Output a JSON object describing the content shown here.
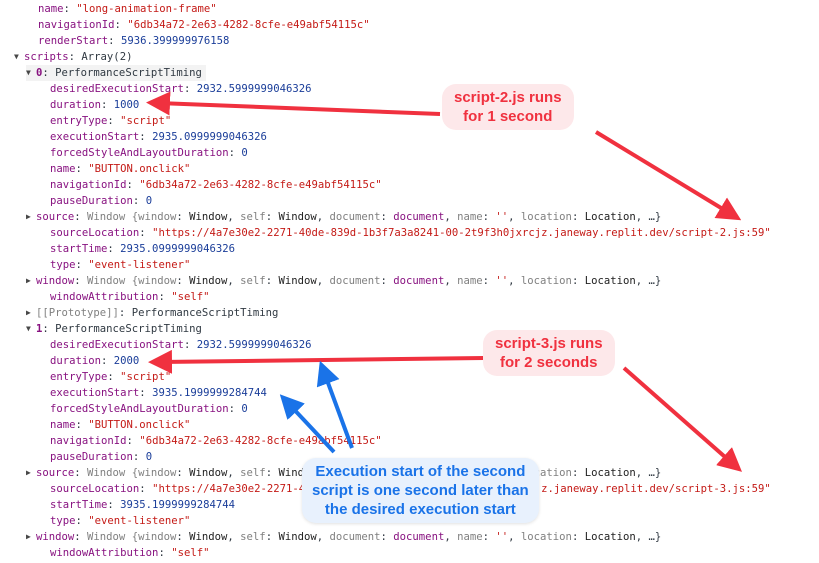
{
  "console": {
    "rows": [
      {
        "indent": 1,
        "key": "name",
        "type": "string",
        "value": "\"long-animation-frame\""
      },
      {
        "indent": 1,
        "key": "navigationId",
        "type": "string",
        "value": "\"6db34a72-2e63-4282-8cfe-e49abf54115c\""
      },
      {
        "indent": 1,
        "key": "renderStart",
        "type": "number",
        "value": "5936.399999976158"
      },
      {
        "indent": 0,
        "toggle": "expanded",
        "key": "scripts",
        "type": "text",
        "value": "Array(2)"
      },
      {
        "indent": 1,
        "toggle": "expanded",
        "index": true,
        "key": "0",
        "type": "text",
        "value": "PerformanceScriptTiming",
        "highlight": true
      },
      {
        "indent": 2,
        "key": "desiredExecutionStart",
        "type": "number",
        "value": "2932.5999999046326"
      },
      {
        "indent": 2,
        "key": "duration",
        "type": "number",
        "value": "1000"
      },
      {
        "indent": 2,
        "key": "entryType",
        "type": "string",
        "value": "\"script\""
      },
      {
        "indent": 2,
        "key": "executionStart",
        "type": "number",
        "value": "2935.0999999046326"
      },
      {
        "indent": 2,
        "key": "forcedStyleAndLayoutDuration",
        "type": "number",
        "value": "0"
      },
      {
        "indent": 2,
        "key": "name",
        "type": "string",
        "value": "\"BUTTON.onclick\""
      },
      {
        "indent": 2,
        "key": "navigationId",
        "type": "string",
        "value": "\"6db34a72-2e63-4282-8cfe-e49abf54115c\""
      },
      {
        "indent": 2,
        "key": "pauseDuration",
        "type": "number",
        "value": "0"
      },
      {
        "indent": 1,
        "toggle": "collapsed",
        "key": "source",
        "type": "window",
        "value": "Window {window: Window, self: Window, document: document, name: '', location: Location, …}"
      },
      {
        "indent": 2,
        "key": "sourceLocation",
        "type": "string",
        "value": "\"https://4a7e30e2-2271-40de-839d-1b3f7a3a8241-00-2t9f3h0jxrcjz.janeway.replit.dev/script-2.js:59\""
      },
      {
        "indent": 2,
        "key": "startTime",
        "type": "number",
        "value": "2935.0999999046326"
      },
      {
        "indent": 2,
        "key": "type",
        "type": "string",
        "value": "\"event-listener\""
      },
      {
        "indent": 1,
        "toggle": "collapsed",
        "key": "window",
        "type": "window",
        "value": "Window {window: Window, self: Window, document: document, name: '', location: Location, …}"
      },
      {
        "indent": 2,
        "key": "windowAttribution",
        "type": "string",
        "value": "\"self\""
      },
      {
        "indent": 1,
        "toggle": "collapsed",
        "key": "[[Prototype]]",
        "type": "text",
        "value": "PerformanceScriptTiming",
        "proto": true
      },
      {
        "indent": 1,
        "toggle": "expanded",
        "index": true,
        "key": "1",
        "type": "text",
        "value": "PerformanceScriptTiming"
      },
      {
        "indent": 2,
        "key": "desiredExecutionStart",
        "type": "number",
        "value": "2932.5999999046326"
      },
      {
        "indent": 2,
        "key": "duration",
        "type": "number",
        "value": "2000"
      },
      {
        "indent": 2,
        "key": "entryType",
        "type": "string",
        "value": "\"script\""
      },
      {
        "indent": 2,
        "key": "executionStart",
        "type": "number",
        "value": "3935.1999999284744"
      },
      {
        "indent": 2,
        "key": "forcedStyleAndLayoutDuration",
        "type": "number",
        "value": "0"
      },
      {
        "indent": 2,
        "key": "name",
        "type": "string",
        "value": "\"BUTTON.onclick\""
      },
      {
        "indent": 2,
        "key": "navigationId",
        "type": "string",
        "value": "\"6db34a72-2e63-4282-8cfe-e49abf54115c\""
      },
      {
        "indent": 2,
        "key": "pauseDuration",
        "type": "number",
        "value": "0"
      },
      {
        "indent": 1,
        "toggle": "collapsed",
        "key": "source",
        "type": "window",
        "value": "Window {window: Window, self: Window, document: document, name: '', location: Location, …}"
      },
      {
        "indent": 2,
        "key": "sourceLocation",
        "type": "string",
        "value": "\"https://4a7e30e2-2271-40de-839d-1b3f7a3a8241-00-2t9f3h0jxrcjz.janeway.replit.dev/script-3.js:59\""
      },
      {
        "indent": 2,
        "key": "startTime",
        "type": "number",
        "value": "3935.1999999284744"
      },
      {
        "indent": 2,
        "key": "type",
        "type": "string",
        "value": "\"event-listener\""
      },
      {
        "indent": 1,
        "toggle": "collapsed",
        "key": "window",
        "type": "window",
        "value": "Window {window: Window, self: Window, document: document, name: '', location: Location, …}"
      },
      {
        "indent": 2,
        "key": "windowAttribution",
        "type": "string",
        "value": "\"self\""
      }
    ]
  },
  "annotations": {
    "script2": {
      "line1": "script-2.js runs",
      "line2": "for 1 second"
    },
    "script3": {
      "line1": "script-3.js runs",
      "line2": "for 2 seconds"
    },
    "execution": {
      "line1": "Execution start of the second",
      "line2": "script is one second later than",
      "line3": "the desired execution start"
    }
  },
  "colors": {
    "annotation_red": "#f0313f",
    "annotation_blue": "#1a73e8"
  }
}
